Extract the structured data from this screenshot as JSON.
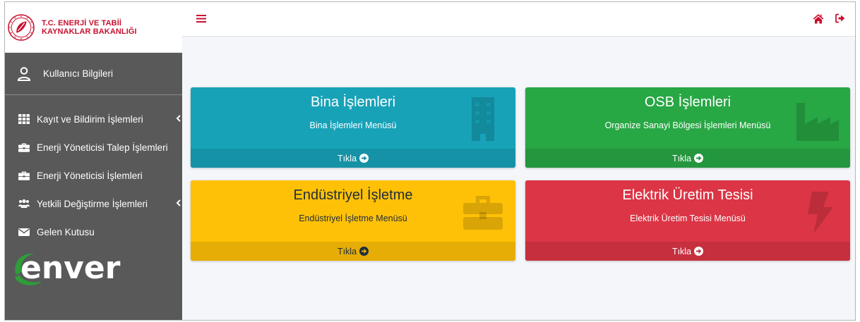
{
  "brand": {
    "line1": "T.C. ENERJİ VE TABİİ",
    "line2": "KAYNAKLAR BAKANLIĞI",
    "product_name": "enver"
  },
  "sidebar": {
    "user_label": "Kullanıcı Bilgileri",
    "items": [
      {
        "label": "Kayıt ve Bildirim İşlemleri",
        "icon": "grid-icon",
        "has_submenu": true
      },
      {
        "label": "Enerji Yöneticisi Talep İşlemleri",
        "icon": "briefcase-icon",
        "has_submenu": false
      },
      {
        "label": "Enerji Yöneticisi İşlemleri",
        "icon": "briefcase-icon",
        "has_submenu": false
      },
      {
        "label": "Yetkili Değiştirme İşlemleri",
        "icon": "users-icon",
        "has_submenu": true
      },
      {
        "label": "Gelen Kutusu",
        "icon": "envelope-icon",
        "has_submenu": false
      }
    ]
  },
  "topbar": {
    "menu_icon": "hamburger-icon",
    "home_icon": "home-icon",
    "logout_icon": "sign-out-icon"
  },
  "cards": [
    {
      "title": "Bina İşlemleri",
      "subtitle": "Bina İşlemleri Menüsü",
      "link": "Tıkla",
      "icon": "building-icon",
      "color": "#17a2b8"
    },
    {
      "title": "OSB İşlemleri",
      "subtitle": "Organize Sanayi Bölgesi İşlemleri Menüsü",
      "link": "Tıkla",
      "icon": "industry-icon",
      "color": "#28a745"
    },
    {
      "title": "Endüstriyel İşletme",
      "subtitle": "Endüstriyel İşletme Menüsü",
      "link": "Tıkla",
      "icon": "briefcase-icon",
      "color": "#ffc107"
    },
    {
      "title": "Elektrik Üretim Tesisi",
      "subtitle": "Elektrik Üretim Tesisi Menüsü",
      "link": "Tıkla",
      "icon": "bolt-icon",
      "color": "#dc3545"
    }
  ],
  "colors": {
    "sidebar_bg": "#595959",
    "brand_red": "#c8102e",
    "content_bg": "#f4f6f9",
    "topbar_icons": "#c8102e"
  }
}
